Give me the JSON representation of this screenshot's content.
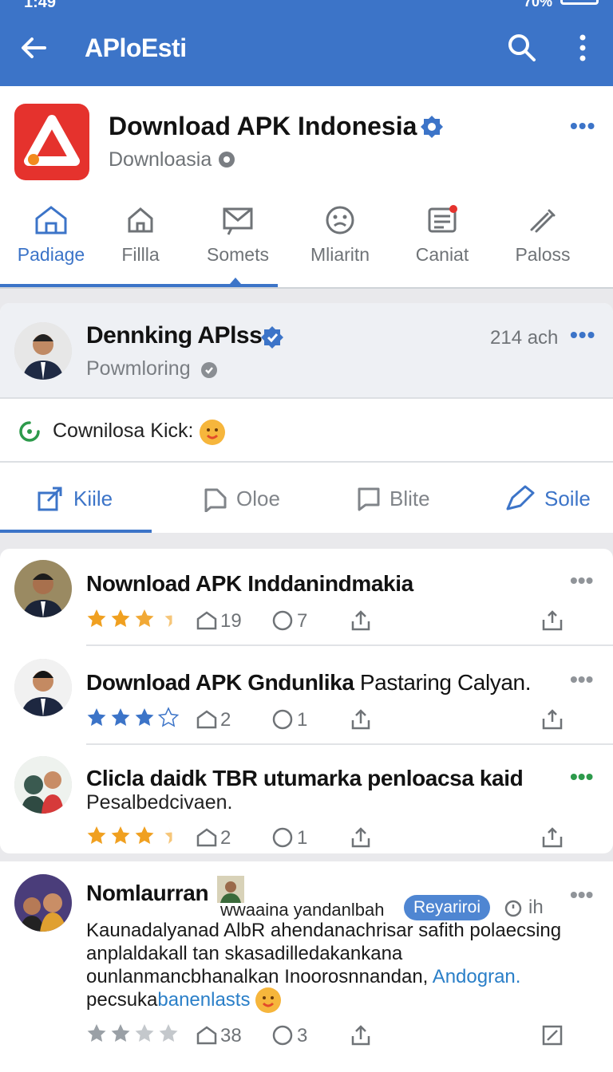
{
  "status_bar": {
    "time": "1:49",
    "battery": "70%"
  },
  "appbar": {
    "title": "APloEsti"
  },
  "app_header": {
    "name": "Download APK Indonesia",
    "subtitle": "Downloasia"
  },
  "nav_tabs": [
    {
      "label": "Padiage",
      "icon": "home-icon",
      "active": true
    },
    {
      "label": "Fillla",
      "icon": "house-icon",
      "active": false
    },
    {
      "label": "Somets",
      "icon": "message-icon",
      "active": false
    },
    {
      "label": "Mliaritn",
      "icon": "face-icon",
      "active": false
    },
    {
      "label": "Caniat",
      "icon": "notes-icon",
      "active": false
    },
    {
      "label": "Paloss",
      "icon": "link-icon",
      "active": false
    }
  ],
  "post": {
    "author": "Dennking APlss",
    "subtitle": "Powmloring",
    "time": "214 ach",
    "text": "Cownilosa Kick:",
    "actions": [
      {
        "label": "Kiile",
        "icon": "share-box-icon",
        "active": true
      },
      {
        "label": "Oloe",
        "icon": "comment-icon",
        "active": false
      },
      {
        "label": "Blite",
        "icon": "bookmark-icon",
        "active": false
      },
      {
        "label": "Soile",
        "icon": "send-icon",
        "active": true
      }
    ]
  },
  "feed_items": [
    {
      "title": "Nownload APK Inddanindmakia",
      "subtitle": "",
      "rating": 2.5,
      "stars_color": "#f0a020",
      "reposts": "19",
      "likes": "7"
    },
    {
      "title": "Download APK Gndunlika",
      "title_rest": "Pastaring Calyan.",
      "subtitle": "",
      "rating": 3.0,
      "stars_color": "#3c74c8",
      "reposts": "2",
      "likes": "1"
    },
    {
      "title": "Clicla daidk TBR utumarka penloacsa kaid",
      "subtitle": "Pesalbedcivaen.",
      "rating": 2.5,
      "stars_color": "#f0a020",
      "reposts": "2",
      "likes": "1"
    }
  ],
  "feed_post": {
    "author": "Nomlaurran",
    "handle": "wwaaina yandanlbah",
    "badge": "Reyariroi",
    "time": "ih",
    "body": "Kaunadalyanad AlbR ahendanachrisar safith polaecsing anplaldakall tan skasadilledakankana ounlanmancbhanalkan Inoorosnnandan,",
    "body_link": "Andogran.",
    "body_tail": "pecsuka",
    "body_tail_link": "banenlasts",
    "rating": 2.0,
    "stars_color": "#9aa0a6",
    "reposts": "38",
    "likes": "3"
  },
  "colors": {
    "primary": "#3c74c8",
    "logo_red": "#e5322d",
    "star_gold": "#f0a020",
    "green": "#2d9a4b"
  }
}
